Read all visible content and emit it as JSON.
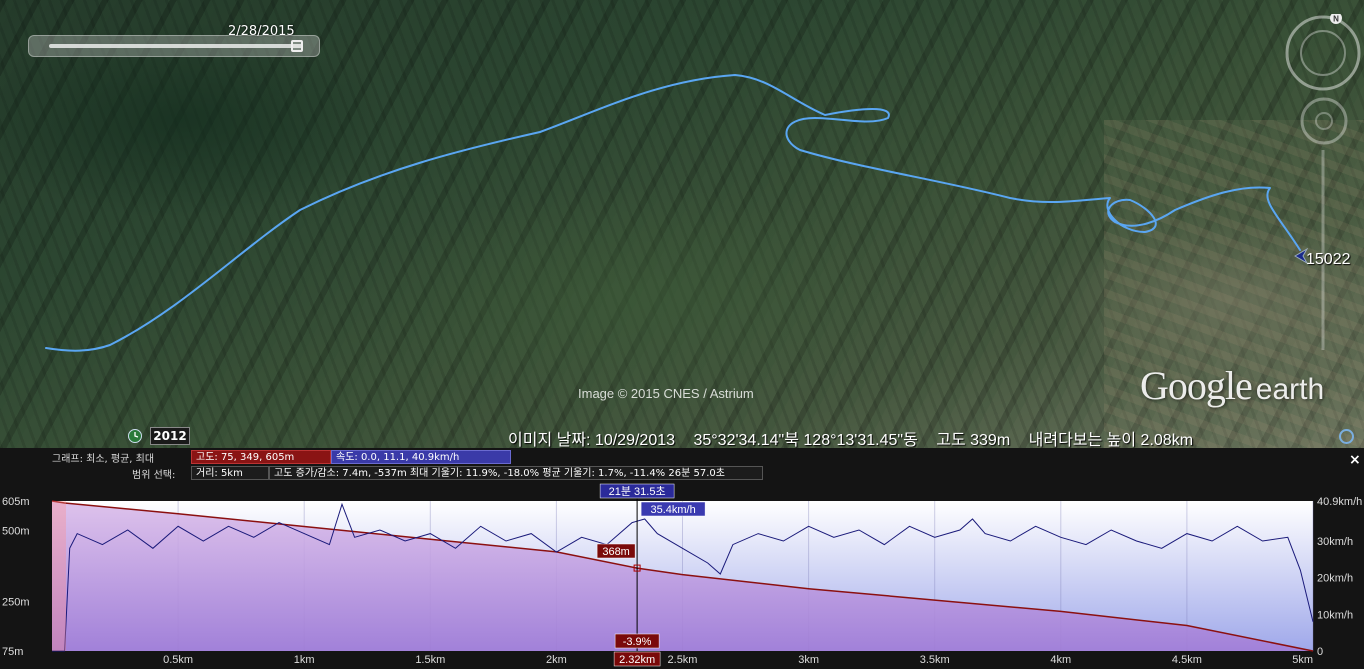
{
  "map": {
    "time_slider_date": "2/28/2015",
    "end_marker_label": "15022",
    "attribution": "Image © 2015 CNES / Astrium",
    "logo_main": "Google",
    "logo_sub": "earth",
    "year_badge": "2012"
  },
  "status_bar": {
    "image_date": "이미지 날짜: 10/29/2013",
    "coords": "35°32'34.14\"북 128°13'31.45\"동",
    "elevation": "고도   339m",
    "eye_alt": "내려다보는 높이    2.08km"
  },
  "profile": {
    "close_label": "×",
    "graph_label": "그래프: 최소, 평균, 최대",
    "range_label": "범위 선택:",
    "alt_stats": "고도: 75, 349, 605m",
    "speed_stats": "속도: 0.0, 11.1, 40.9km/h",
    "distance": "거리: 5km",
    "gain_loss": "고도 증가/감소: 7.4m, -537m   최대 기울기: 11.9%, -18.0%   평균 기울기: 1.7%, -11.4%   26분 57.0초"
  },
  "chart_data": {
    "type": "area",
    "xlim": [
      0,
      5
    ],
    "x_unit": "km",
    "x_ticks": [
      "0.5km",
      "1km",
      "1.5km",
      "2km",
      "2.5km",
      "3km",
      "3.5km",
      "4km",
      "4.5km",
      "5km"
    ],
    "x_tick_values": [
      0.5,
      1,
      1.5,
      2,
      2.5,
      3,
      3.5,
      4,
      4.5,
      5
    ],
    "left_axis": {
      "ticks": [
        "605m",
        "500m",
        "250m",
        "75m"
      ],
      "values": [
        605,
        500,
        250,
        75
      ],
      "ylim": [
        75,
        605
      ]
    },
    "right_axis": {
      "ticks": [
        "40.9km/h",
        "30km/h",
        "20km/h",
        "10km/h",
        "0"
      ],
      "values": [
        40.9,
        30,
        20,
        10,
        0
      ],
      "ylim": [
        0,
        40.9
      ]
    },
    "series": [
      {
        "color": "#8b1010",
        "axis": "left",
        "x": [
          0,
          0.05,
          0.5,
          1.0,
          1.5,
          2.0,
          2.32,
          2.5,
          3.0,
          3.5,
          4.0,
          4.5,
          5.0
        ],
        "values": [
          605,
          598,
          560,
          515,
          470,
          425,
          368,
          345,
          295,
          255,
          215,
          165,
          75
        ]
      },
      {
        "color": "#1a1a7a",
        "axis": "right",
        "x": [
          0,
          0.05,
          0.07,
          0.1,
          0.2,
          0.3,
          0.4,
          0.5,
          0.6,
          0.7,
          0.8,
          0.9,
          1.0,
          1.1,
          1.15,
          1.2,
          1.3,
          1.4,
          1.5,
          1.6,
          1.7,
          1.8,
          1.9,
          2.0,
          2.1,
          2.2,
          2.3,
          2.35,
          2.4,
          2.5,
          2.6,
          2.65,
          2.7,
          2.8,
          2.9,
          3.0,
          3.1,
          3.2,
          3.3,
          3.4,
          3.5,
          3.6,
          3.65,
          3.7,
          3.8,
          3.9,
          4.0,
          4.1,
          4.2,
          4.3,
          4.4,
          4.5,
          4.6,
          4.7,
          4.8,
          4.9,
          4.95,
          5.0
        ],
        "values": [
          0,
          0,
          28,
          32,
          29,
          33,
          28,
          34,
          30,
          34,
          31,
          35,
          32,
          29,
          40,
          31,
          33,
          30,
          32,
          28,
          34,
          30,
          32,
          27,
          31,
          29,
          35,
          36,
          32,
          28,
          24,
          21,
          29,
          32,
          30,
          34,
          31,
          33,
          29,
          34,
          31,
          33,
          36,
          32,
          30,
          34,
          31,
          29,
          33,
          30,
          28,
          32,
          30,
          34,
          30,
          31,
          22,
          8
        ]
      }
    ],
    "cursor": {
      "x": 2.32,
      "x_label": "2.32km",
      "time_label": "21분 31.5초",
      "speed_label": "35.4km/h",
      "alt_label": "368m",
      "slope_label": "-3.9%"
    }
  }
}
